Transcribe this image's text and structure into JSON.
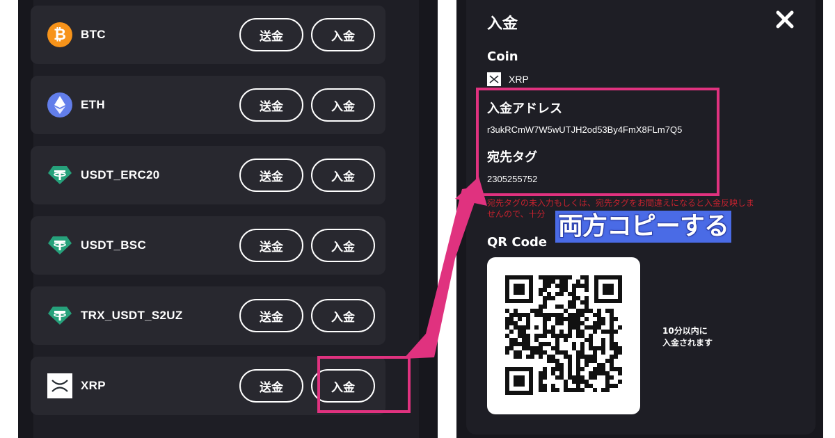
{
  "left": {
    "coins": [
      {
        "name": "BTC",
        "icon": "bitcoin-icon",
        "send": "送金",
        "receive": "入金"
      },
      {
        "name": "ETH",
        "icon": "ethereum-icon",
        "send": "送金",
        "receive": "入金"
      },
      {
        "name": "USDT_ERC20",
        "icon": "tether-icon",
        "send": "送金",
        "receive": "入金"
      },
      {
        "name": "USDT_BSC",
        "icon": "tether-icon",
        "send": "送金",
        "receive": "入金"
      },
      {
        "name": "TRX_USDT_S2UZ",
        "icon": "tether-icon",
        "send": "送金",
        "receive": "入金"
      },
      {
        "name": "XRP",
        "icon": "xrp-icon",
        "send": "送金",
        "receive": "入金"
      }
    ]
  },
  "modal": {
    "title": "入金",
    "coin_label": "Coin",
    "coin_value": "XRP",
    "address_label": "入金アドレス",
    "address_value": "r3ukRCmW7W5wUTJH2od53By4FmX8FLm7Q5",
    "tag_label": "宛先タグ",
    "tag_value": "2305255752",
    "warning_line1": "宛先タグの未入力もしくは、宛先タグをお間違えになると入金反映しま",
    "warning_line2": "せんので、十分",
    "qr_label": "QR Code",
    "qr_note_line1": "10分以内に",
    "qr_note_line2": "入金されます"
  },
  "annotation": {
    "callout": "両方コピーする",
    "highlight_color": "#e0327f",
    "callout_color": "#4a6be6"
  },
  "colors": {
    "btc": "#f7931a",
    "eth": "#627eea",
    "tether": "#26a17b",
    "panel": "#1e1e25",
    "row": "#28282f"
  }
}
